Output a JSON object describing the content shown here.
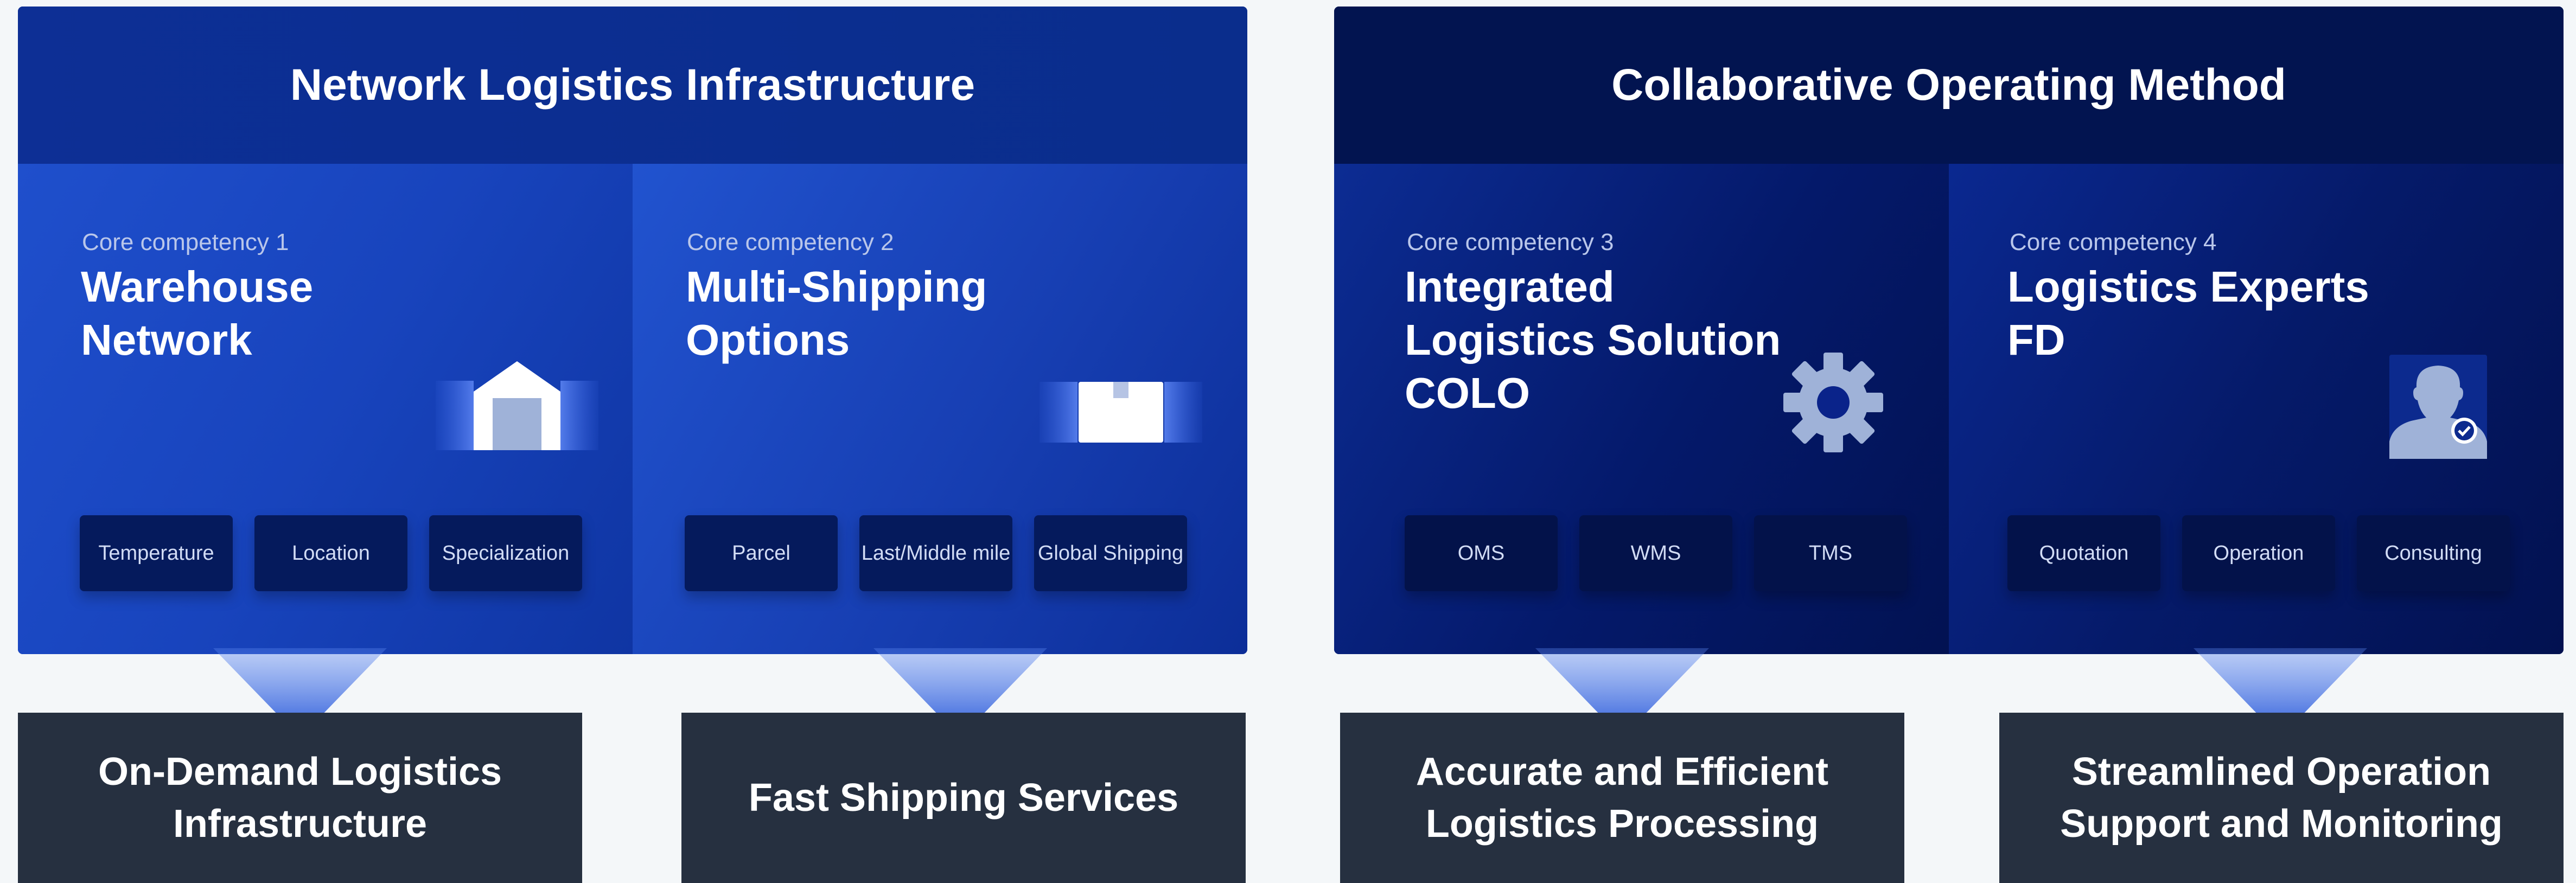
{
  "panels": {
    "left": {
      "title": "Network Logistics Infrastructure",
      "cards": [
        {
          "subtitle": "Core competency 1",
          "title": "Warehouse Network",
          "icon": "warehouse-icon",
          "chips": [
            "Temperature",
            "Location",
            "Specialization"
          ]
        },
        {
          "subtitle": "Core competency 2",
          "title": "Multi-Shipping Options",
          "icon": "box-icon",
          "chips": [
            "Parcel",
            "Last/Middle mile",
            "Global Shipping"
          ]
        }
      ]
    },
    "right": {
      "title": "Collaborative Operating Method",
      "cards": [
        {
          "subtitle": "Core competency 3",
          "title": "Integrated Logistics Solution COLO",
          "icon": "gear-icon",
          "chips": [
            "OMS",
            "WMS",
            "TMS"
          ]
        },
        {
          "subtitle": "Core competency 4",
          "title": "Logistics Experts FD",
          "icon": "expert-icon",
          "chips": [
            "Quotation",
            "Operation",
            "Consulting"
          ]
        }
      ]
    }
  },
  "results": [
    "On-Demand Logistics Infrastructure",
    "Fast Shipping Services",
    "Accurate and Efficient Logistics Processing",
    "Streamlined Operation Support and Monitoring"
  ],
  "colors": {
    "left_panel": "#0b2f8f",
    "right_panel": "#02124a",
    "result_box": "#263040",
    "funnel": "#2f62e0",
    "page_background": "#f4f7f9"
  }
}
